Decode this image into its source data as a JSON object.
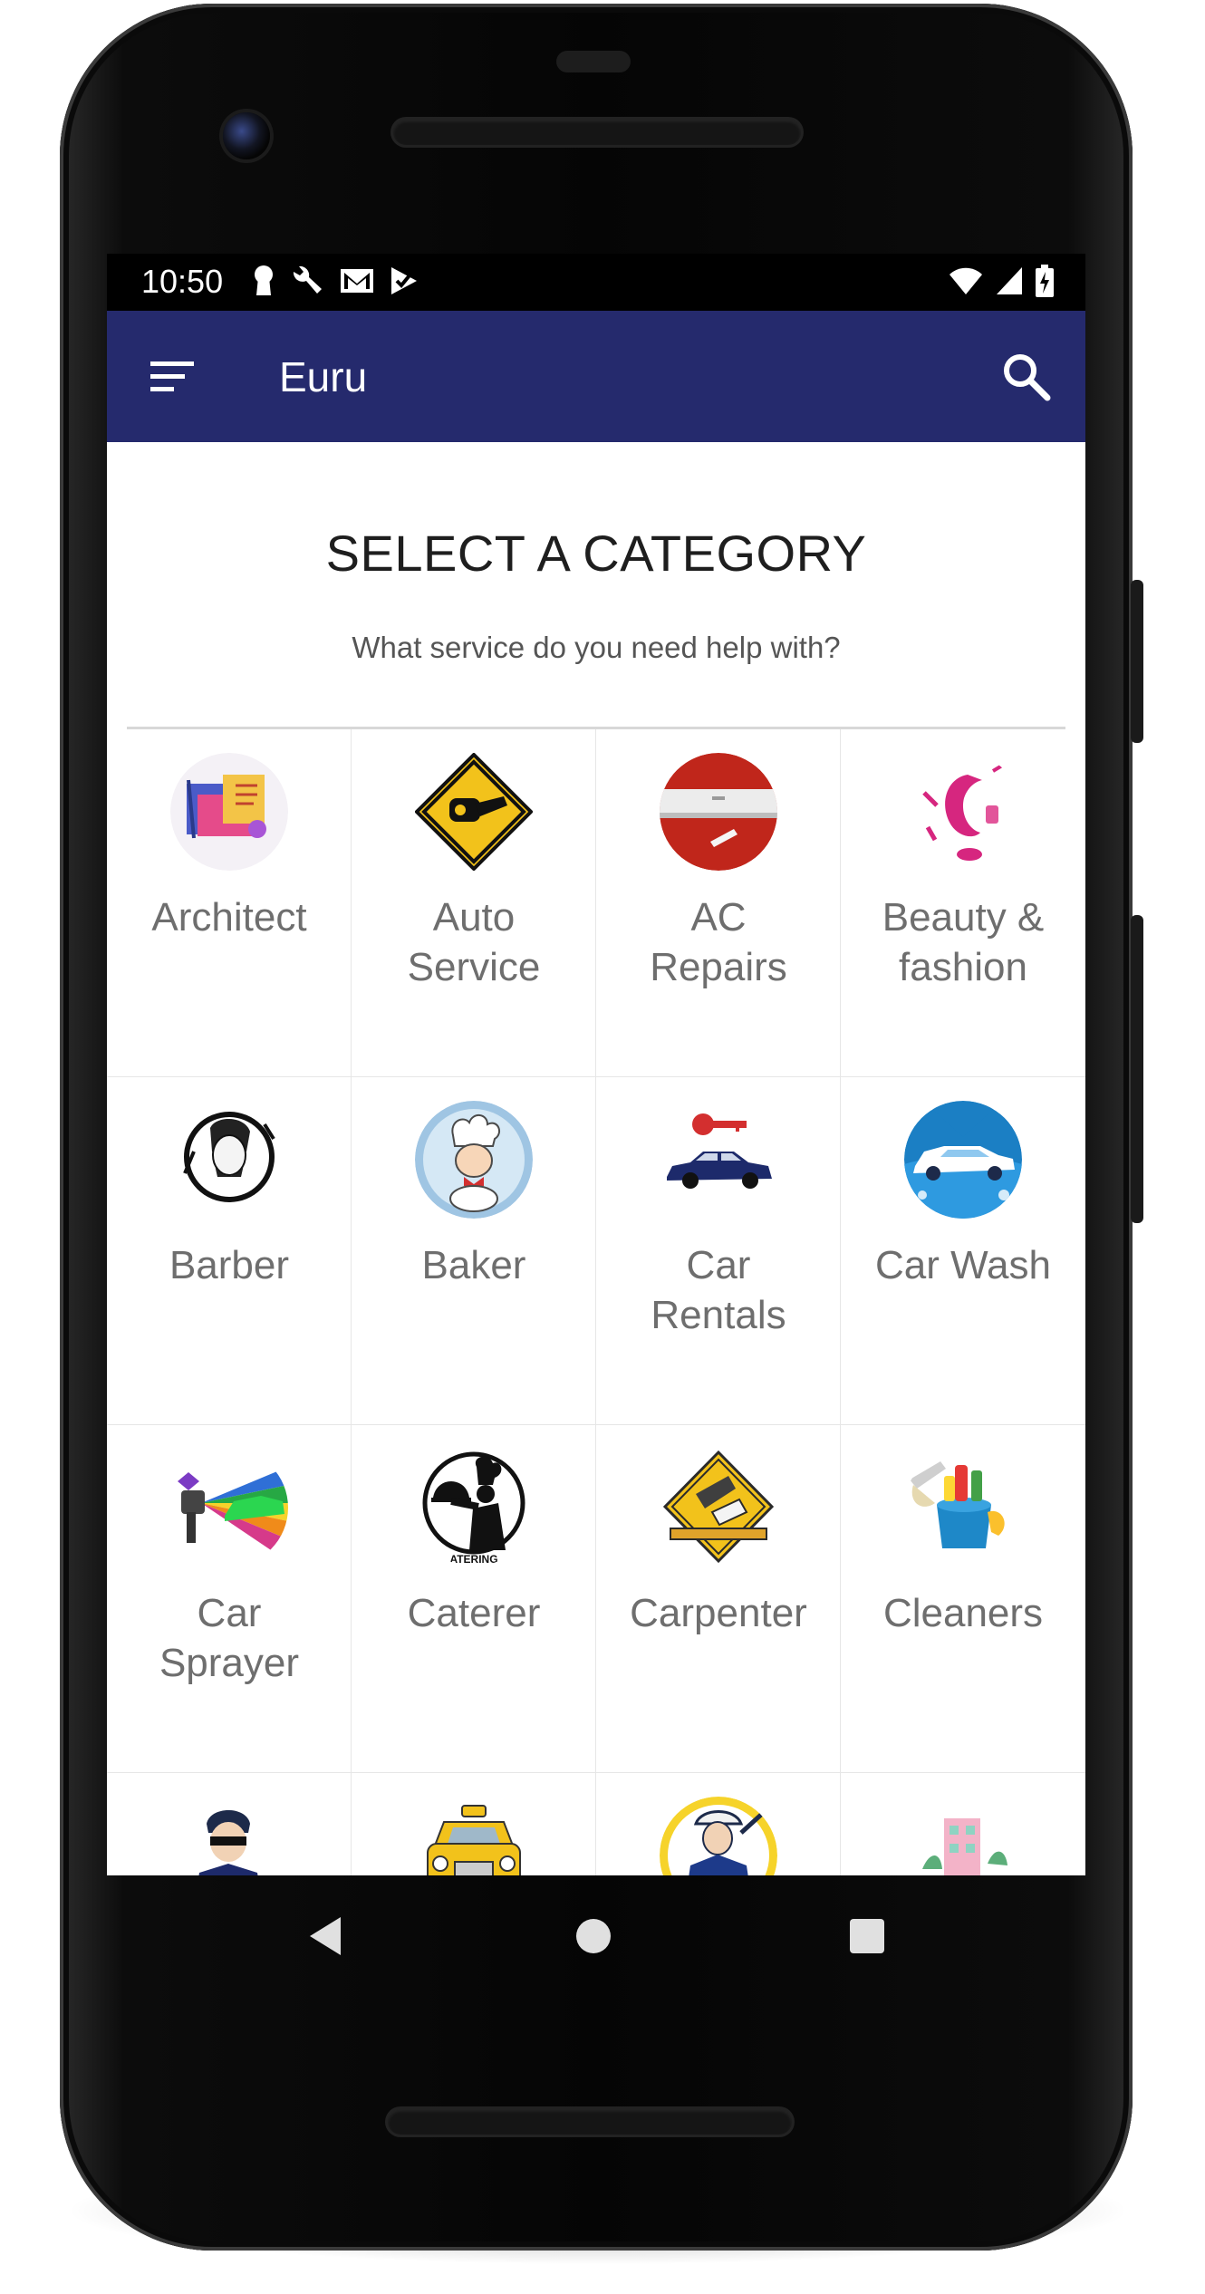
{
  "status_bar": {
    "time": "10:50"
  },
  "app_bar": {
    "title": "Euru"
  },
  "header": {
    "title": "SELECT A CATEGORY",
    "subtitle": "What service do you need help with?"
  },
  "categories": [
    {
      "label_line1": "Architect",
      "label_line2": "",
      "icon": "architect-icon"
    },
    {
      "label_line1": "Auto",
      "label_line2": "Service",
      "icon": "auto-service-icon"
    },
    {
      "label_line1": "AC",
      "label_line2": "Repairs",
      "icon": "ac-repairs-icon"
    },
    {
      "label_line1": "Beauty &",
      "label_line2": "fashion",
      "icon": "beauty-fashion-icon"
    },
    {
      "label_line1": "Barber",
      "label_line2": "",
      "icon": "barber-icon"
    },
    {
      "label_line1": "Baker",
      "label_line2": "",
      "icon": "baker-icon"
    },
    {
      "label_line1": "Car",
      "label_line2": "Rentals",
      "icon": "car-rentals-icon"
    },
    {
      "label_line1": "Car Wash",
      "label_line2": "",
      "icon": "car-wash-icon"
    },
    {
      "label_line1": "Car",
      "label_line2": "Sprayer",
      "icon": "car-sprayer-icon"
    },
    {
      "label_line1": "Caterer",
      "label_line2": "",
      "icon": "caterer-icon"
    },
    {
      "label_line1": "Carpenter",
      "label_line2": "",
      "icon": "carpenter-icon"
    },
    {
      "label_line1": "Cleaners",
      "label_line2": "",
      "icon": "cleaners-icon"
    },
    {
      "label_line1": "",
      "label_line2": "",
      "icon": "security-guard-icon"
    },
    {
      "label_line1": "",
      "label_line2": "",
      "icon": "taxi-icon"
    },
    {
      "label_line1": "",
      "label_line2": "",
      "icon": "electrician-icon"
    },
    {
      "label_line1": "",
      "label_line2": "",
      "icon": "building-icon"
    }
  ],
  "colors": {
    "app_bar": "#252a6d",
    "label_text": "#6e6e6e"
  }
}
